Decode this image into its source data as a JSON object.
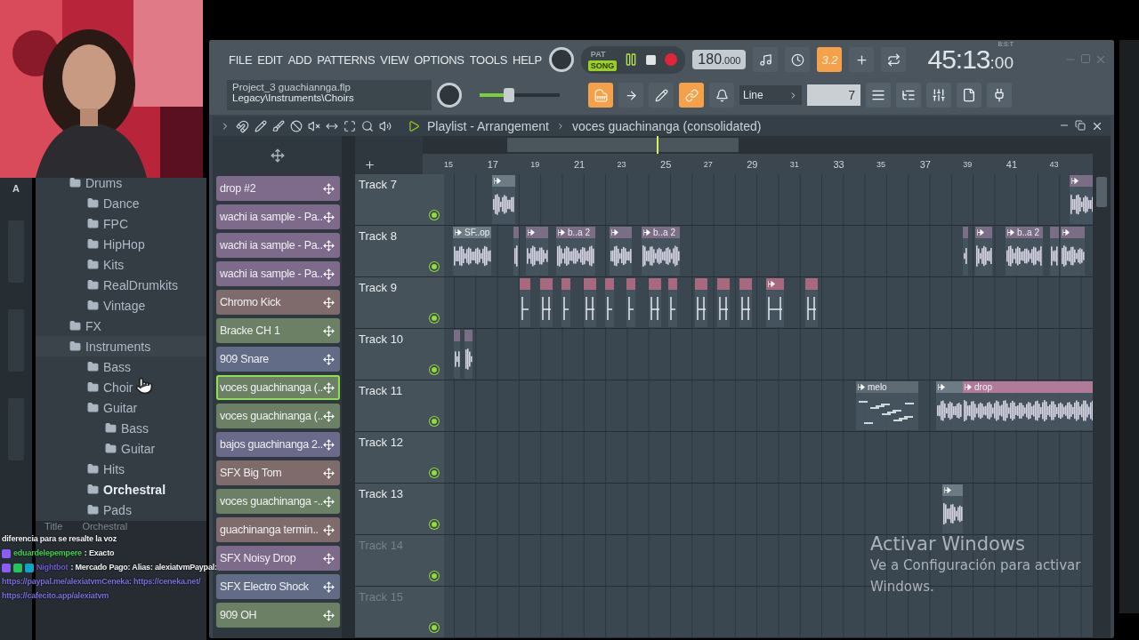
{
  "side_strip": {
    "label": "A"
  },
  "browser": {
    "items": [
      {
        "label": "Drums",
        "selected": false,
        "children": [
          {
            "label": "Dance",
            "selected": false
          },
          {
            "label": "FPC",
            "selected": false
          },
          {
            "label": "HipHop",
            "selected": false
          },
          {
            "label": "Kits",
            "selected": false
          },
          {
            "label": "RealDrumkits",
            "selected": false
          },
          {
            "label": "Vintage",
            "selected": false
          }
        ]
      },
      {
        "label": "FX",
        "selected": false
      },
      {
        "label": "Instruments",
        "selected": false,
        "children": [
          {
            "label": "Bass",
            "selected": false
          },
          {
            "label": "Choir",
            "selected": false
          },
          {
            "label": "Guitar",
            "selected": false,
            "children": [
              {
                "label": "Bass",
                "selected": false
              },
              {
                "label": "Guitar",
                "selected": false
              }
            ]
          },
          {
            "label": "Hits",
            "selected": false
          },
          {
            "label": "Orchestral",
            "selected": true
          },
          {
            "label": "Pads",
            "selected": false
          }
        ]
      }
    ]
  },
  "info": {
    "rows": [
      {
        "key": "Title",
        "value": "Orchestral"
      }
    ]
  },
  "chat": [
    {
      "kind": "text",
      "text": "diferencia para se resalte la voz"
    },
    {
      "kind": "message",
      "user": "eduardelepempere",
      "color": "#3fd24a",
      "text": ": Exacto"
    },
    {
      "kind": "bot_message",
      "user": "Nightbot",
      "color": "#6b5bd6",
      "text": ": Mercado Pago: Alias: alexiatvmPaypal:"
    },
    {
      "kind": "link",
      "text": "https://paypal.me/alexiatvmCeneka: https://ceneka.net/"
    },
    {
      "kind": "link",
      "text": "https://cafecito.app/alexiatvm"
    }
  ],
  "toolbar": {
    "menu": [
      "FILE",
      "EDIT",
      "ADD",
      "PATTERNS",
      "VIEW",
      "OPTIONS",
      "TOOLS",
      "HELP"
    ],
    "pat_song": [
      {
        "label": "PAT",
        "selected": false
      },
      {
        "label": "SONG",
        "selected": true
      }
    ],
    "tempo": "180",
    "tempo_fraction": ".000",
    "mode_button": {
      "label": "3.2",
      "on": true
    },
    "time": "45:13",
    "time_ticks": ":00",
    "time_format": "B:S:T"
  },
  "toolbar2": {
    "file": "Project_3 guachiannga.flp",
    "hint": "Legacy\\Instruments\\Choirs",
    "master_pitch": {
      "level": 0.35
    },
    "buttons": [
      {
        "on": true
      },
      {
        "on": false
      },
      {
        "on": false
      },
      {
        "on": true
      },
      {
        "on": false
      }
    ],
    "snap": "Line",
    "pattern_number": "7"
  },
  "playlist": {
    "title": "Playlist - Arrangement",
    "clip_name": "voces guachinanga (consolidated)",
    "ruler": [
      "15",
      "17",
      "19",
      "21",
      "23",
      "25",
      "27",
      "29",
      "31",
      "33",
      "35",
      "37",
      "39",
      "41",
      "43"
    ],
    "patterns": [
      {
        "name": "drop #2",
        "color": "#7e6a8a",
        "selected": false
      },
      {
        "name": "wachi ia sample - Pa..",
        "color": "#7e6a8a",
        "selected": false
      },
      {
        "name": "wachi ia sample - Pa..",
        "color": "#7e6a8a",
        "selected": false
      },
      {
        "name": "wachi ia sample - Pa..",
        "color": "#7e6a8a",
        "selected": false
      },
      {
        "name": "Chromo Kick",
        "color": "#7f6b6b",
        "selected": false
      },
      {
        "name": "Bracke CH 1",
        "color": "#6c8066",
        "selected": false
      },
      {
        "name": "909 Snare",
        "color": "#626c86",
        "selected": false
      },
      {
        "name": "voces guachinanga (..",
        "color": "#6c8066",
        "selected": true
      },
      {
        "name": "voces guachinanga (..",
        "color": "#6c8066",
        "selected": false
      },
      {
        "name": "bajos guachinanga 2..",
        "color": "#6c6a8a",
        "selected": false
      },
      {
        "name": "SFX Big Tom",
        "color": "#7f6b6b",
        "selected": false
      },
      {
        "name": "voces guachinanga -..",
        "color": "#6c8066",
        "selected": false
      },
      {
        "name": "guachinanga termin..",
        "color": "#7f6b6b",
        "selected": false
      },
      {
        "name": "SFX Noisy Drop",
        "color": "#7e6a8a",
        "selected": false
      },
      {
        "name": "SFX Electro Shock",
        "color": "#626c86",
        "selected": false
      },
      {
        "name": "909 OH",
        "color": "#6c8066",
        "selected": false
      }
    ],
    "tracks": [
      {
        "name": "Track 7",
        "dimmed": false,
        "clips": [
          {
            "kind": "audio",
            "color": "#6d7c84"
          },
          {
            "kind": "audio",
            "color": "#7c6d86"
          }
        ]
      },
      {
        "name": "Track 8",
        "dimmed": false,
        "clips": [
          {
            "kind": "audio",
            "label": "SF..op",
            "color": "#6d7c84"
          },
          {
            "kind": "audio",
            "color": "#7c6d86"
          },
          {
            "kind": "audio",
            "color": "#7c6d86"
          },
          {
            "kind": "audio",
            "label": "b..a 2",
            "color": "#7c6d86"
          },
          {
            "kind": "audio",
            "color": "#7c6d86"
          },
          {
            "kind": "audio",
            "label": "b..a 2",
            "color": "#7c6d86"
          },
          {
            "kind": "audio",
            "color": "#7c6d86"
          },
          {
            "kind": "audio",
            "color": "#7c6d86"
          },
          {
            "kind": "audio",
            "label": "b..a 2",
            "color": "#7c6d86"
          },
          {
            "kind": "audio",
            "color": "#7c6d86"
          },
          {
            "kind": "audio",
            "color": "#7c6d86"
          }
        ]
      },
      {
        "name": "Track 9",
        "dimmed": false,
        "clips": [
          {
            "kind": "ticks",
            "color": "#a8687e"
          },
          {
            "kind": "ticks",
            "color": "#a8687e"
          },
          {
            "kind": "ticks",
            "color": "#a8687e"
          },
          {
            "kind": "ticks",
            "color": "#a8687e"
          },
          {
            "kind": "ticks",
            "color": "#a8687e"
          },
          {
            "kind": "ticks",
            "color": "#a8687e"
          },
          {
            "kind": "ticks",
            "color": "#a8687e"
          },
          {
            "kind": "ticks",
            "color": "#a8687e"
          },
          {
            "kind": "ticks",
            "color": "#a8687e"
          },
          {
            "kind": "ticks",
            "color": "#a8687e"
          },
          {
            "kind": "ticks",
            "color": "#a8687e"
          },
          {
            "kind": "ticks",
            "color": "#a8687e"
          },
          {
            "kind": "ticks",
            "color": "#a8687e"
          }
        ]
      },
      {
        "name": "Track 10",
        "dimmed": false,
        "clips": [
          {
            "kind": "audio",
            "color": "#7c6d86"
          },
          {
            "kind": "audio",
            "color": "#7c6d86"
          }
        ]
      },
      {
        "name": "Track 11",
        "dimmed": false,
        "clips": [
          {
            "kind": "pattern",
            "label": "melo",
            "color": "#5f6b72"
          },
          {
            "kind": "audio",
            "color": "#6d7c84"
          },
          {
            "kind": "audio",
            "label": "drop",
            "color": "#b07a98"
          }
        ]
      },
      {
        "name": "Track 12",
        "dimmed": false
      },
      {
        "name": "Track 13",
        "dimmed": false,
        "clips": [
          {
            "kind": "audio",
            "color": "#6d7c84"
          }
        ]
      },
      {
        "name": "Track 14",
        "dimmed": true
      },
      {
        "name": "Track 15",
        "dimmed": true
      }
    ]
  },
  "activation_notice": {
    "title": "Activar Windows",
    "text": "Ve a Configuración para activar Windows."
  }
}
